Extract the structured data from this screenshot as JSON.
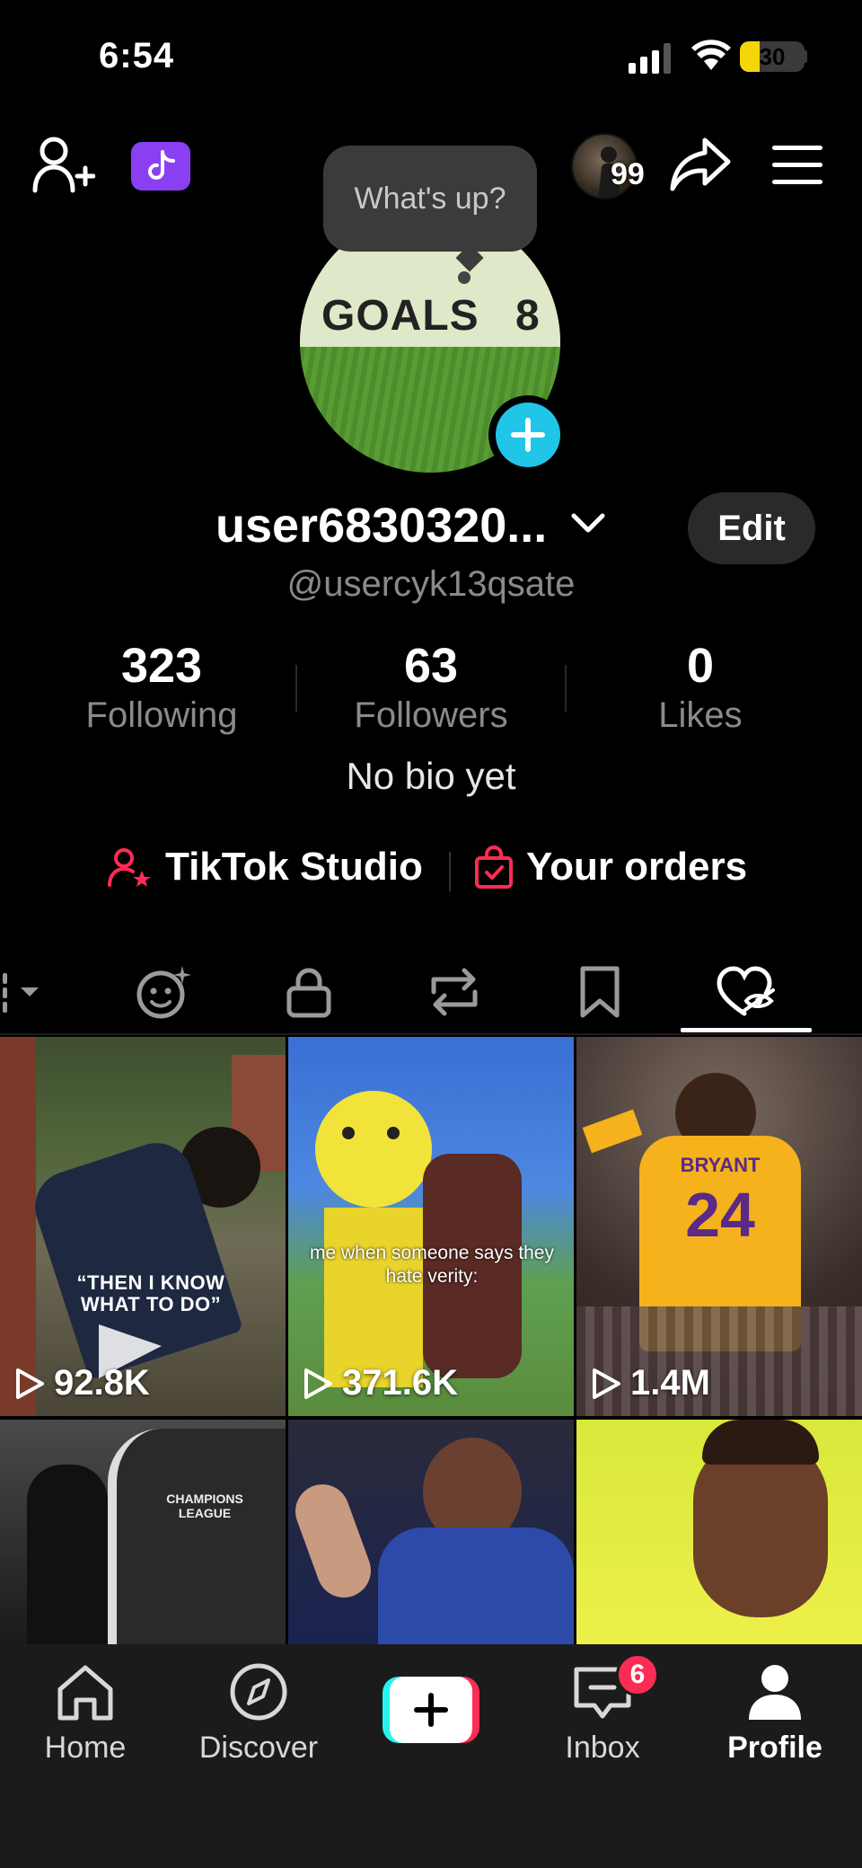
{
  "status_bar": {
    "time": "6:54",
    "battery": "30",
    "battery_level": 0.3
  },
  "top_bar": {
    "story_count": "99"
  },
  "tooltip": {
    "text": "What's up?"
  },
  "avatar": {
    "goals_text": "GOALS",
    "number_text": "8"
  },
  "profile": {
    "username": "user6830320...",
    "handle": "@usercyk13qsate",
    "edit_label": "Edit",
    "bio": "No bio yet"
  },
  "stats": [
    {
      "value": "323",
      "label": "Following"
    },
    {
      "value": "63",
      "label": "Followers"
    },
    {
      "value": "0",
      "label": "Likes"
    }
  ],
  "links": {
    "studio": "TikTok Studio",
    "orders": "Your orders"
  },
  "tabs": [
    "videos",
    "stickers",
    "private",
    "reposts",
    "favorites",
    "liked"
  ],
  "active_tab": "liked",
  "grid": [
    {
      "views": "92.8K",
      "caption": "“THEN I KNOW WHAT TO DO”"
    },
    {
      "views": "371.6K",
      "caption": "me when someone says they hate verity:"
    },
    {
      "views": "1.4M",
      "jersey_name": "BRYANT",
      "jersey_number": "24"
    },
    {
      "views": "",
      "banner_text": "CHAMPIONS LEAGUE"
    },
    {
      "views": ""
    },
    {
      "views": ""
    }
  ],
  "bottom_nav": {
    "home": "Home",
    "discover": "Discover",
    "inbox": "Inbox",
    "inbox_badge": "6",
    "profile": "Profile"
  },
  "colors": {
    "accent_cyan": "#20c5e8",
    "brand_red": "#fe2c55",
    "studio_purple": "#8a3ff3"
  }
}
